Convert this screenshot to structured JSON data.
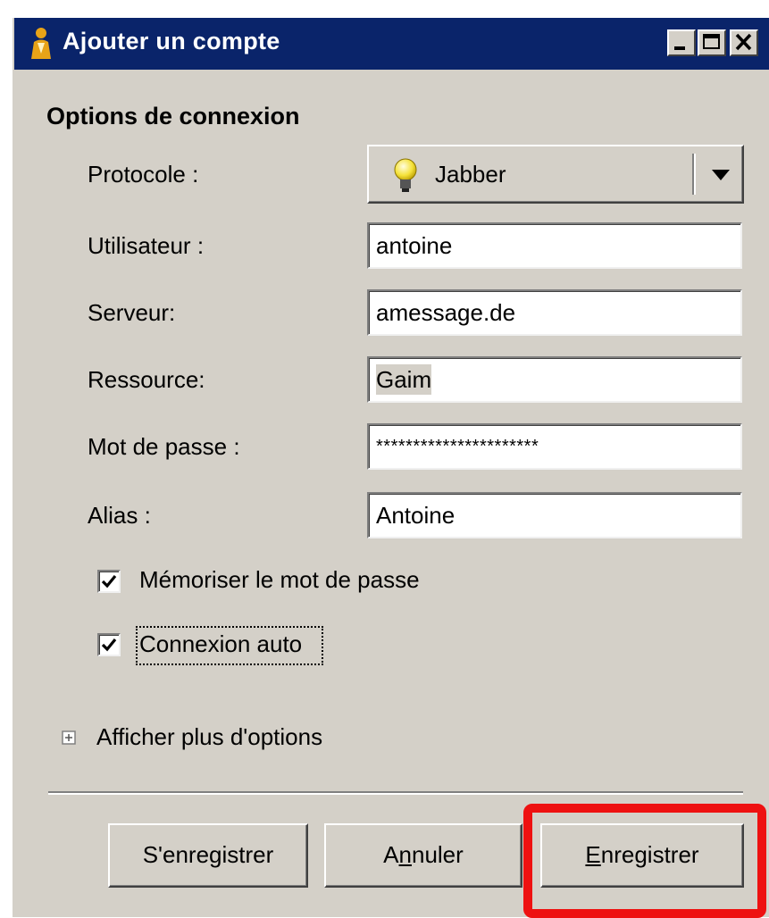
{
  "window": {
    "title": "Ajouter un compte",
    "title_icon": "gaim-user-icon"
  },
  "titlebar_buttons": [
    "minimize-icon",
    "maximize-icon",
    "close-icon"
  ],
  "section": {
    "title": "Options de connexion"
  },
  "fields": {
    "protocol": {
      "label": "Protocole :",
      "value": "Jabber",
      "icon": "lightbulb-icon"
    },
    "user": {
      "label": "Utilisateur :",
      "value": "antoine"
    },
    "server": {
      "label": "Serveur:",
      "value": "amessage.de"
    },
    "resource": {
      "label": "Ressource:",
      "value": "Gaim"
    },
    "password": {
      "label": "Mot de passe :",
      "value": "**********************"
    },
    "alias": {
      "label": "Alias :",
      "value": "Antoine"
    }
  },
  "checkboxes": {
    "remember_password": {
      "label": "Mémoriser le mot de passe",
      "checked": true
    },
    "auto_login": {
      "label": "Connexion auto",
      "checked": true
    }
  },
  "expander": {
    "label": "Afficher plus d'options",
    "icon": "plus-box-icon"
  },
  "buttons": {
    "register": {
      "label": "S'enregistrer"
    },
    "cancel": {
      "pre": "A",
      "mnemonic": "n",
      "post": "nuler"
    },
    "save": {
      "pre": "",
      "mnemonic": "E",
      "post": "nregistrer"
    }
  },
  "annotation": {
    "highlight_color": "#ee1111",
    "target": "save-button"
  }
}
